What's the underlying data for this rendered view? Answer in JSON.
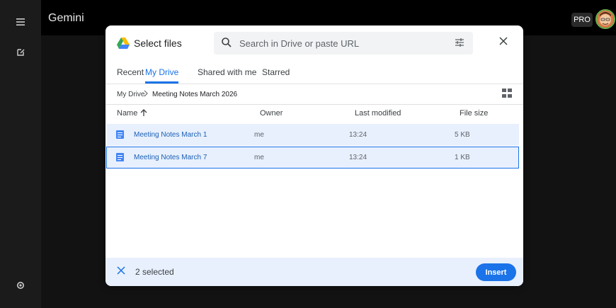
{
  "app": {
    "title": "Gemini",
    "badge": "PRO"
  },
  "dialog": {
    "title": "Select files",
    "search_placeholder": "Search in Drive or paste URL",
    "tabs": [
      "Recent",
      "My Drive",
      "Shared with me",
      "Starred"
    ],
    "active_tab": "My Drive",
    "breadcrumb": [
      "My Drive",
      "Meeting Notes March 2026"
    ],
    "columns": {
      "name": "Name",
      "owner": "Owner",
      "modified": "Last modified",
      "size": "File size"
    },
    "rows": [
      {
        "name": "Meeting Notes March 1",
        "owner": "me",
        "modified": "13:24",
        "size": "5 KB"
      },
      {
        "name": "Meeting Notes March 7",
        "owner": "me",
        "modified": "13:24",
        "size": "1 KB"
      }
    ],
    "footer": {
      "selected": "2 selected",
      "insert": "Insert"
    }
  },
  "icons": [
    "menu-icon",
    "new-chat-icon",
    "settings-icon",
    "drive-logo-icon",
    "search-icon",
    "filter-icon",
    "close-icon",
    "grid-view-icon",
    "sort-arrow-icon",
    "doc-icon"
  ],
  "colors": {
    "accent": "#1a73e8",
    "selection": "#e8f0fe",
    "background": "#121212"
  }
}
